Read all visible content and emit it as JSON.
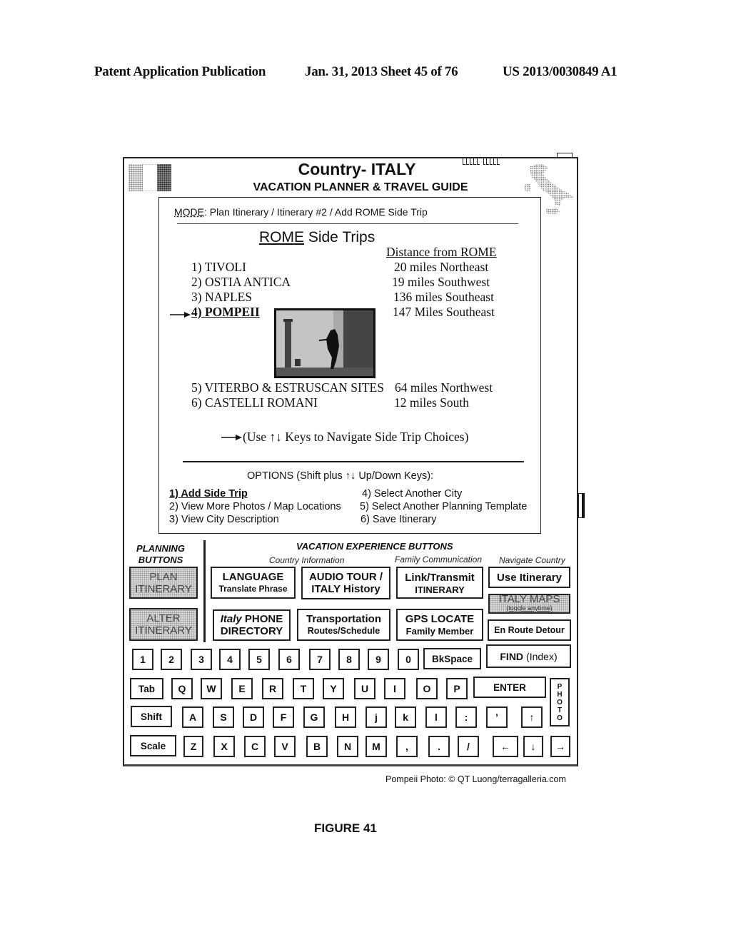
{
  "publication_header": {
    "left": "Patent Application Publication",
    "middle": "Jan. 31, 2013  Sheet 45 of 76",
    "right": "US 2013/0030849 A1"
  },
  "app": {
    "title": "Country- ITALY",
    "subtitle": "VACATION PLANNER & TRAVEL GUIDE"
  },
  "mode": {
    "label": "MODE",
    "value": ": Plan Itinerary / Itinerary #2 / Add ROME Side Trip"
  },
  "side_trips": {
    "title_underlined": "ROME",
    "title_rest": " Side Trips",
    "distance_header": "Distance from ROME",
    "items": [
      {
        "name": "1) TIVOLI",
        "distance": "20 miles Northeast",
        "selected": false
      },
      {
        "name": "2) OSTIA ANTICA",
        "distance": "19 miles Southwest",
        "selected": false
      },
      {
        "name": "3) NAPLES",
        "distance": "136 miles Southeast",
        "selected": false
      },
      {
        "name": "4) POMPEII",
        "distance": "147 Miles Southeast",
        "selected": true
      },
      {
        "name": "5) VITERBO & ESTRUSCAN SITES",
        "distance": "64 miles Northwest",
        "selected": false
      },
      {
        "name": "6) CASTELLI ROMANI",
        "distance": "12 miles South",
        "selected": false
      }
    ],
    "nav_hint": "(Use ↑↓ Keys to Navigate Side Trip Choices)",
    "photo_alt": "Pompeii photo"
  },
  "options": {
    "title": "OPTIONS (Shift plus ↑↓ Up/Down Keys):",
    "items": [
      {
        "label": "1) Add Side Trip",
        "active": true
      },
      {
        "label": "2) View More Photos / Map Locations",
        "active": false
      },
      {
        "label": "3) View City Description",
        "active": false
      },
      {
        "label": "4) Select Another City",
        "active": false
      },
      {
        "label": "5) Select Another Planning Template",
        "active": false
      },
      {
        "label": "6) Save Itinerary",
        "active": false
      }
    ]
  },
  "planning_buttons": {
    "label_line1": "PLANNING",
    "label_line2": "BUTTONS",
    "items": [
      {
        "line1": "PLAN",
        "line2": "ITINERARY"
      },
      {
        "line1": "ALTER",
        "line2": "ITINERARY"
      }
    ]
  },
  "vacation_buttons": {
    "label": "VACATION EXPERIENCE BUTTONS",
    "categories": [
      "Country Information",
      "Family Communication",
      "Navigate Country"
    ],
    "items": [
      {
        "line1": "LANGUAGE",
        "line2": "Translate Phrase"
      },
      {
        "line1": "AUDIO TOUR /",
        "line2": "ITALY History"
      },
      {
        "line1": "Link/Transmit",
        "line2": "ITINERARY"
      },
      {
        "line1": "Use Itinerary",
        "line2": ""
      },
      {
        "line1": "ITALY MAPS",
        "line2": "(toggle anytime)"
      },
      {
        "line1_italic": "Italy",
        "line1": " PHONE",
        "line2": "DIRECTORY"
      },
      {
        "line1": "Transportation",
        "line2": "Routes/Schedule"
      },
      {
        "line1": "GPS LOCATE",
        "line2": "Family Member"
      },
      {
        "line1": "En Route Detour",
        "line2": ""
      }
    ]
  },
  "keyboard": {
    "row1": [
      "1",
      "2",
      "3",
      "4",
      "5",
      "6",
      "7",
      "8",
      "9",
      "0",
      "BkSpace"
    ],
    "find": {
      "bold": "FIND",
      "rest": "(Index)"
    },
    "row2": [
      "Tab",
      "Q",
      "W",
      "E",
      "R",
      "T",
      "Y",
      "U",
      "I",
      "O",
      "P",
      "ENTER"
    ],
    "row3": [
      "Shift",
      "A",
      "S",
      "D",
      "F",
      "G",
      "H",
      "j",
      "k",
      "l",
      ":",
      "’",
      "↑"
    ],
    "row4": [
      "Scale",
      "Z",
      "X",
      "C",
      "V",
      "B",
      "N",
      "M",
      ",",
      ".",
      "/",
      "←",
      "↓",
      "→"
    ],
    "photo_key": [
      "P",
      "H",
      "O",
      "T",
      "O"
    ]
  },
  "photo_credit": "Pompeii Photo: © QT Luong/terragalleria.com",
  "figure_label": "FIGURE 41"
}
